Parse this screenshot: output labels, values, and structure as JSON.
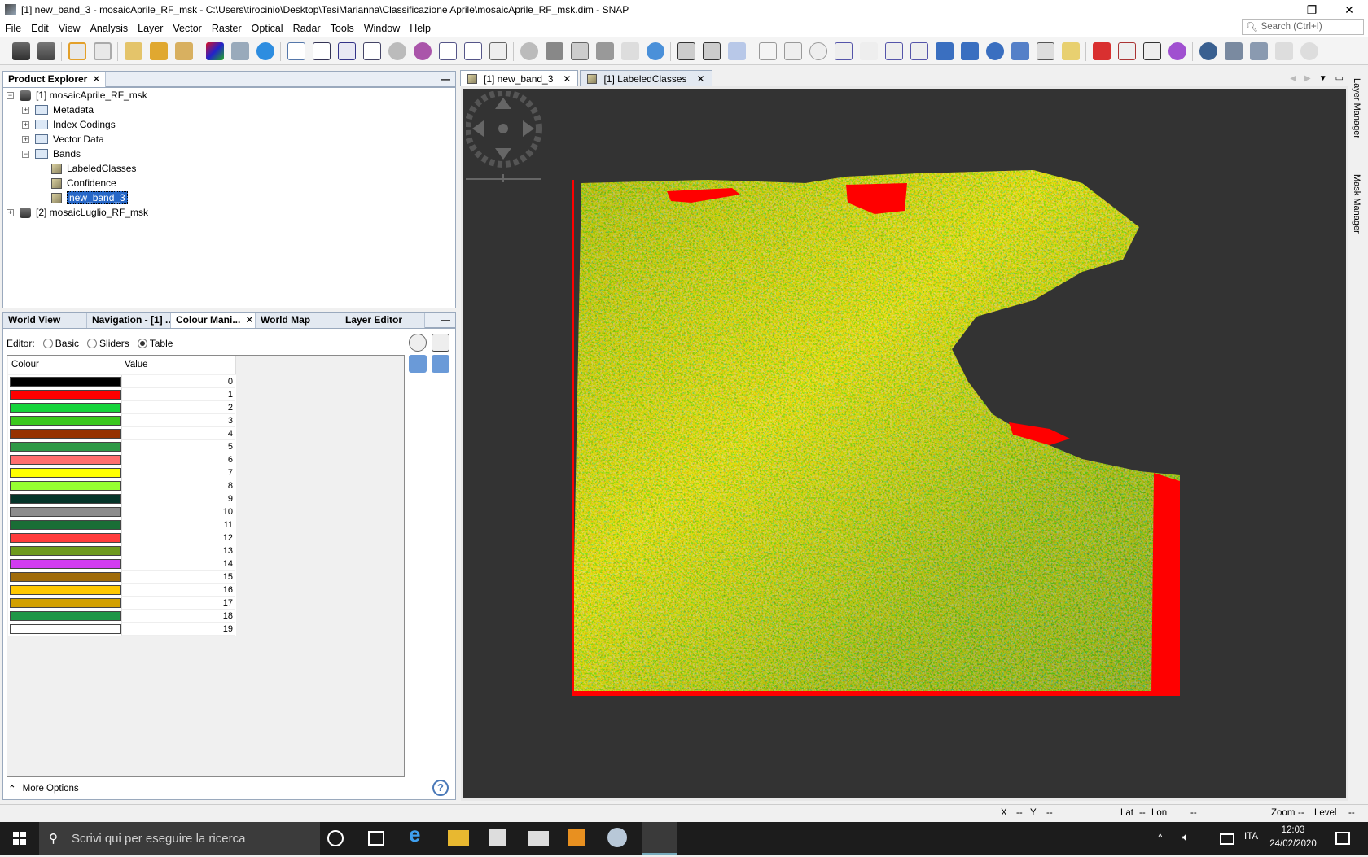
{
  "window": {
    "title": "[1] new_band_3 - mosaicAprile_RF_msk - C:\\Users\\tirocinio\\Desktop\\TesiMarianna\\Classificazione Aprile\\mosaicAprile_RF_msk.dim - SNAP",
    "minimize": "—",
    "restore": "❐",
    "close": "✕"
  },
  "menu": [
    "File",
    "Edit",
    "View",
    "Analysis",
    "Layer",
    "Vector",
    "Raster",
    "Optical",
    "Radar",
    "Tools",
    "Window",
    "Help"
  ],
  "search": {
    "placeholder": "Search (Ctrl+I)"
  },
  "product_explorer": {
    "tab_label": "Product Explorer",
    "close": "✕",
    "minimize": "—",
    "tree": {
      "product1": "[1] mosaicAprile_RF_msk",
      "metadata": "Metadata",
      "index_codings": "Index Codings",
      "vector_data": "Vector Data",
      "bands": "Bands",
      "band_labeled": "LabeledClasses",
      "band_confidence": "Confidence",
      "band_new": "new_band_3",
      "product2": "[2] mosaicLuglio_RF_msk"
    }
  },
  "lower_tabs": {
    "world_view": "World View",
    "navigation": "Navigation - [1] ...",
    "colour_manipulation": "Colour Mani...",
    "world_map": "World Map",
    "layer_editor": "Layer Editor",
    "close": "✕",
    "minimize": "—"
  },
  "colour_manipulation": {
    "editor_label": "Editor:",
    "modes": {
      "basic": "Basic",
      "sliders": "Sliders",
      "table": "Table"
    },
    "selected_mode": "Table",
    "col_colour": "Colour",
    "col_value": "Value",
    "rows": [
      {
        "color": "#000000",
        "value": "0"
      },
      {
        "color": "#ff0000",
        "value": "1"
      },
      {
        "color": "#16d43b",
        "value": "2"
      },
      {
        "color": "#3bc81e",
        "value": "3"
      },
      {
        "color": "#963200",
        "value": "4"
      },
      {
        "color": "#2e9946",
        "value": "5"
      },
      {
        "color": "#ff6e6e",
        "value": "6"
      },
      {
        "color": "#ffff00",
        "value": "7"
      },
      {
        "color": "#96ff32",
        "value": "8"
      },
      {
        "color": "#05352a",
        "value": "9"
      },
      {
        "color": "#8c8c8c",
        "value": "10"
      },
      {
        "color": "#1a6e36",
        "value": "11"
      },
      {
        "color": "#ff3c3c",
        "value": "12"
      },
      {
        "color": "#6e9a1e",
        "value": "13"
      },
      {
        "color": "#d23cf0",
        "value": "14"
      },
      {
        "color": "#a06c0a",
        "value": "15"
      },
      {
        "color": "#ffc800",
        "value": "16"
      },
      {
        "color": "#d2a000",
        "value": "17"
      },
      {
        "color": "#1e9646",
        "value": "18"
      },
      {
        "color": "#ffffff",
        "value": "19"
      }
    ],
    "more_options": "More Options",
    "help": "?"
  },
  "document_tabs": [
    {
      "label": "[1] new_band_3",
      "active": true
    },
    {
      "label": "[1] LabeledClasses",
      "active": false
    }
  ],
  "right_sidebar": {
    "layer_manager": "Layer Manager",
    "mask_manager": "Mask Manager"
  },
  "status": {
    "x_label": "X",
    "x_val": "--",
    "y_label": "Y",
    "y_val": "--",
    "lat_label": "Lat",
    "lat_val": "--",
    "lon_label": "Lon",
    "lon_val": "--",
    "zoom_label": "Zoom",
    "zoom_val": "--",
    "level_label": "Level",
    "level_val": "--"
  },
  "taskbar": {
    "search_placeholder": "Scrivi qui per eseguire la ricerca",
    "lang": "ITA",
    "time": "12:03",
    "date": "24/02/2020"
  },
  "colors": {
    "accent": "#2667c7",
    "viewer_bg": "#333333",
    "panel_border": "#9aa9bd"
  }
}
